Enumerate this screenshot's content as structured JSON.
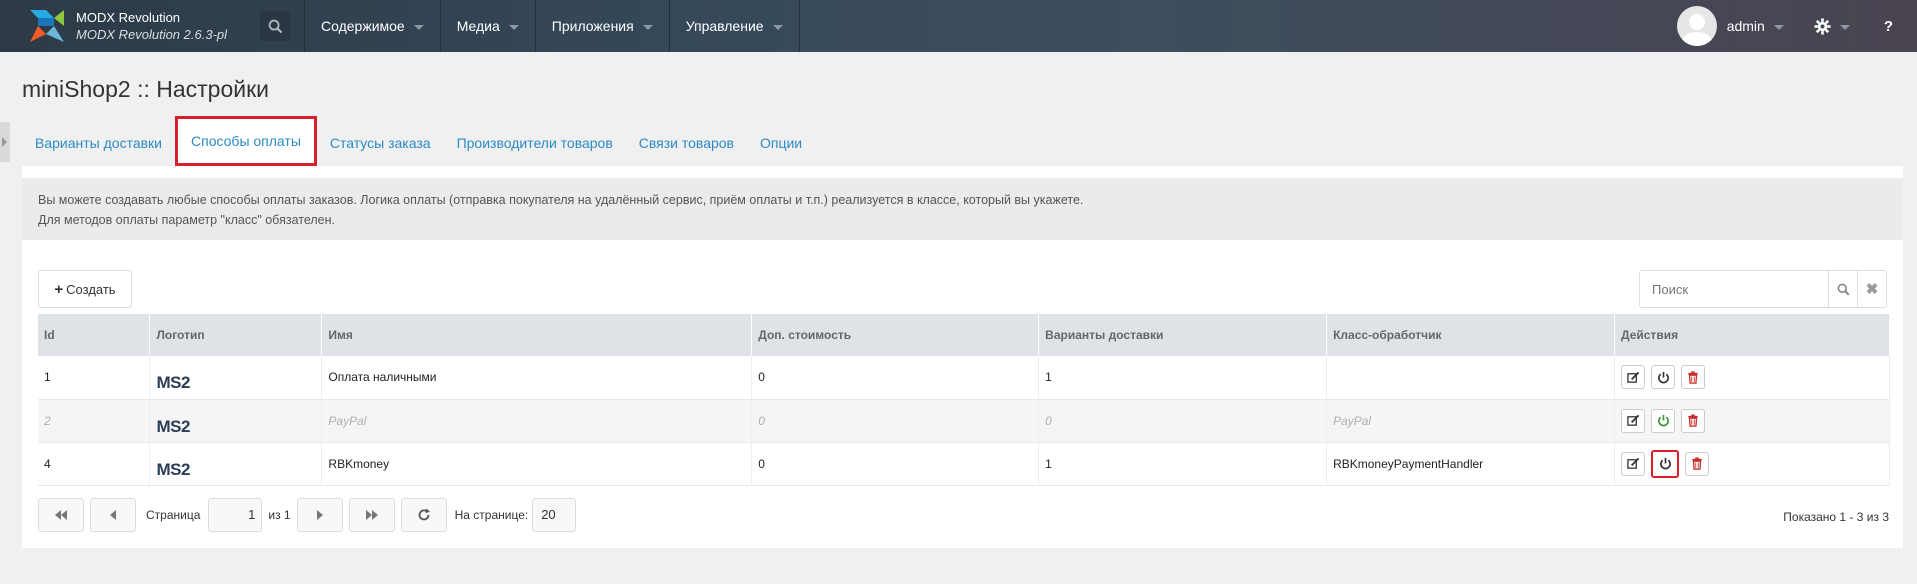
{
  "app": {
    "name": "MODX Revolution",
    "version": "MODX Revolution 2.6.3-pl"
  },
  "topnav": [
    {
      "label": "Содержимое"
    },
    {
      "label": "Медиа"
    },
    {
      "label": "Приложения"
    },
    {
      "label": "Управление"
    }
  ],
  "user": {
    "name": "admin"
  },
  "help": "?",
  "page": {
    "title": "miniShop2 :: Настройки"
  },
  "tabs": [
    {
      "label": "Варианты доставки"
    },
    {
      "label": "Способы оплаты"
    },
    {
      "label": "Статусы заказа"
    },
    {
      "label": "Производители товаров"
    },
    {
      "label": "Связи товаров"
    },
    {
      "label": "Опции"
    }
  ],
  "description": {
    "line1": "Вы можете создавать любые способы оплаты заказов. Логика оплаты (отправка покупателя на удалённый сервис, приём оплаты и т.п.) реализуется в классе, который вы укажете.",
    "line2": "Для методов оплаты параметр \"класс\" обязателен."
  },
  "toolbar": {
    "create_label": "Создать",
    "search_placeholder": "Поиск"
  },
  "table": {
    "headers": [
      "Id",
      "Логотип",
      "Имя",
      "Доп. стоимость",
      "Варианты доставки",
      "Класс-обработчик",
      "Действия"
    ],
    "rows": [
      {
        "id": "1",
        "logo": "MS2",
        "name": "Оплата наличными",
        "price": "0",
        "deliveries": "1",
        "class": ""
      },
      {
        "id": "2",
        "logo": "MS2",
        "name": "PayPal",
        "price": "0",
        "deliveries": "0",
        "class": "PayPal"
      },
      {
        "id": "4",
        "logo": "MS2",
        "name": "RBKmoney",
        "price": "0",
        "deliveries": "1",
        "class": "RBKmoneyPaymentHandler"
      }
    ]
  },
  "pager": {
    "page_label": "Страница",
    "page_value": "1",
    "of_label": "из 1",
    "per_page_label": "На странице:",
    "per_page_value": "20",
    "showing": "Показано 1 - 3 из 3"
  },
  "colors": {
    "accent": "#2b8bc6",
    "highlight": "#d7202b",
    "power_green": "#3a9a3a",
    "delete_red": "#c9302c"
  }
}
